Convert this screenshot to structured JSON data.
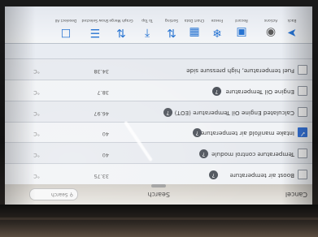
{
  "header": {
    "cancel": "Cancel",
    "title": "Search",
    "search_placeholder": "Search",
    "search_icon": "magnifier-icon"
  },
  "rows": [
    {
      "name": "Boost air temperature",
      "value": "33.75",
      "unit": "°C",
      "checked": false
    },
    {
      "name": "Temperature control module",
      "value": "40",
      "unit": "°C",
      "checked": false
    },
    {
      "name": "Intake manifold air temperature",
      "value": "40",
      "unit": "°C",
      "checked": true
    },
    {
      "name": "Calculated Engine Oil Temperature (EOT)",
      "value": "46.97",
      "unit": "°C",
      "checked": false
    },
    {
      "name": "Engine Oil Temperature",
      "value": "38.7",
      "unit": "°C",
      "checked": false
    },
    {
      "name": "Fuel temperature, high pressure side",
      "value": "34.38",
      "unit": "°C",
      "checked": false
    }
  ],
  "toolbar": {
    "items": [
      {
        "label": "Back",
        "icon": "back-arrow-icon"
      },
      {
        "label": "Actions",
        "icon": "circle-dots-icon"
      },
      {
        "label": "Record",
        "icon": "record-icon"
      },
      {
        "label": "Freeze",
        "icon": "snowflake-icon"
      },
      {
        "label": "Chart Data",
        "icon": "chart-icon"
      },
      {
        "label": "Sorting",
        "icon": "sort-icon"
      },
      {
        "label": "To Top",
        "icon": "arrow-up-icon"
      },
      {
        "label": "Graph Merge",
        "icon": "merge-icon"
      },
      {
        "label": "Show Selected",
        "icon": "check-list-icon"
      },
      {
        "label": "Deselect All",
        "icon": "deselect-icon"
      }
    ]
  },
  "colors": {
    "accent": "#1f6fd1",
    "checkbox_on": "#2f6fd8"
  }
}
